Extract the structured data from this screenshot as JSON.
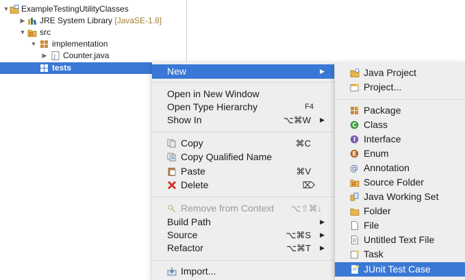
{
  "tree": {
    "project": "ExampleTestingUtilityClasses",
    "jre_label": "JRE System Library",
    "jre_decoration": "[JavaSE-1.8]",
    "src": "src",
    "package_impl": "implementation",
    "file_counter": "Counter.java",
    "package_tests": "tests"
  },
  "context_menu": {
    "new": "New",
    "open_new_window": "Open in New Window",
    "open_type_hierarchy": "Open Type Hierarchy",
    "open_type_hierarchy_shortcut": "F4",
    "show_in": "Show In",
    "show_in_shortcut": "⌥⌘W",
    "copy": "Copy",
    "copy_shortcut": "⌘C",
    "copy_qualified": "Copy Qualified Name",
    "paste": "Paste",
    "paste_shortcut": "⌘V",
    "delete": "Delete",
    "delete_shortcut": "⌦",
    "remove_context": "Remove from Context",
    "remove_context_shortcut": "⌥⇧⌘↓",
    "build_path": "Build Path",
    "source": "Source",
    "source_shortcut": "⌥⌘S",
    "refactor": "Refactor",
    "refactor_shortcut": "⌥⌘T",
    "import": "Import..."
  },
  "submenu": {
    "java_project": "Java Project",
    "project": "Project...",
    "package": "Package",
    "class": "Class",
    "interface": "Interface",
    "enum": "Enum",
    "annotation": "Annotation",
    "source_folder": "Source Folder",
    "java_working_set": "Java Working Set",
    "folder": "Folder",
    "file": "File",
    "untitled_text_file": "Untitled Text File",
    "task": "Task",
    "junit_test_case": "JUnit Test Case"
  },
  "colors": {
    "selection": "#3a78d6",
    "menu_bg": "#eeeeee",
    "decoration": "#a07d2e"
  }
}
